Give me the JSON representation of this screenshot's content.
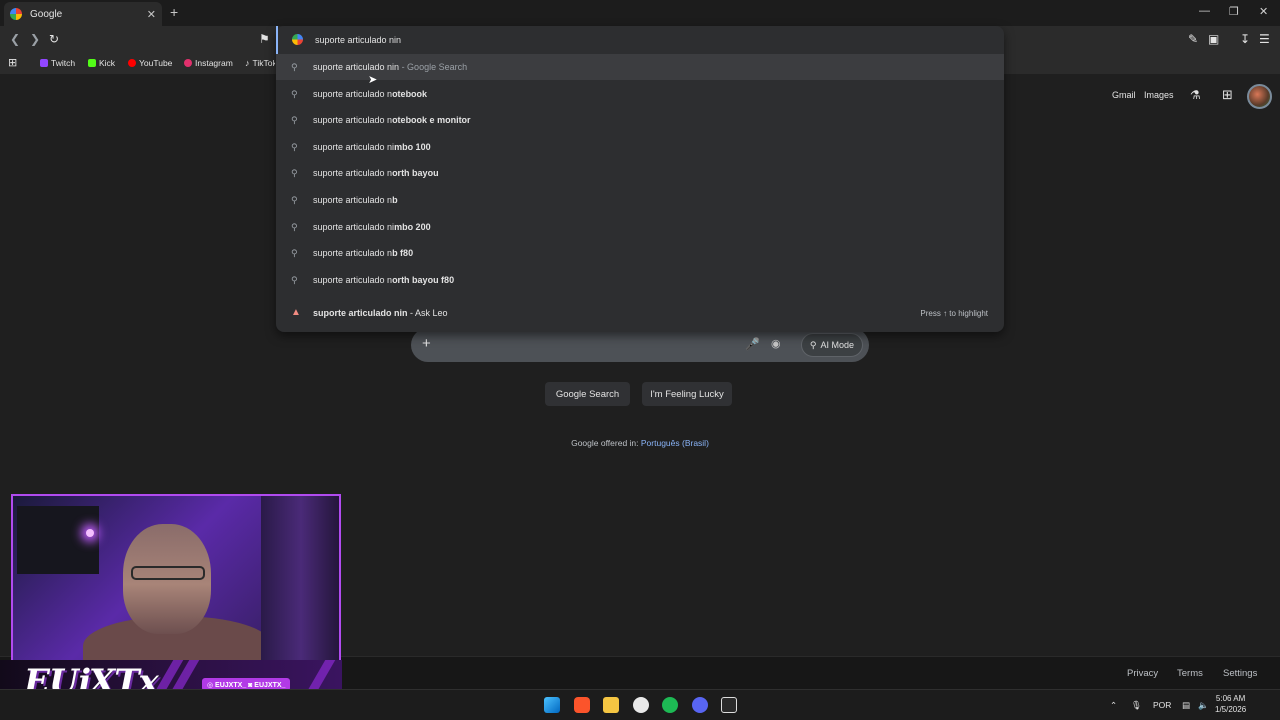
{
  "tab": {
    "title": "Google",
    "close": "✕",
    "new": "+"
  },
  "window": {
    "minimize": "—",
    "restore": "❐",
    "close": "✕"
  },
  "bookmarks": [
    {
      "label": "Twitch",
      "color": "#9146ff"
    },
    {
      "label": "Kick",
      "color": "#53fc18"
    },
    {
      "label": "YouTube",
      "color": "#ff0000"
    },
    {
      "label": "Instagram",
      "color": "#e1306c"
    },
    {
      "label": "TikTok",
      "color": "#ffffff"
    }
  ],
  "omnibox": {
    "value": "suporte articulado nin",
    "suggestions": [
      {
        "prefix": "suporte articulado nin",
        "bold": "",
        "suffix": " - Google Search"
      },
      {
        "prefix": "suporte articulado n",
        "bold": "otebook",
        "suffix": ""
      },
      {
        "prefix": "suporte articulado n",
        "bold": "otebook e monitor",
        "suffix": ""
      },
      {
        "prefix": "suporte articulado ni",
        "bold": "mbo 100",
        "suffix": ""
      },
      {
        "prefix": "suporte articulado n",
        "bold": "orth bayou",
        "suffix": ""
      },
      {
        "prefix": "suporte articulado n",
        "bold": "b",
        "suffix": ""
      },
      {
        "prefix": "suporte articulado ni",
        "bold": "mbo 200",
        "suffix": ""
      },
      {
        "prefix": "suporte articulado n",
        "bold": "b f80",
        "suffix": ""
      },
      {
        "prefix": "suporte articulado n",
        "bold": "orth bayou f80",
        "suffix": ""
      }
    ],
    "ask": {
      "bold": "suporte articulado nin",
      "suffix": " - Ask Leo",
      "hint": "Press ↑ to highlight"
    }
  },
  "header": {
    "gmail": "Gmail",
    "images": "Images"
  },
  "search": {
    "ai_mode": "AI Mode",
    "google_search": "Google Search",
    "lucky": "I'm Feeling Lucky"
  },
  "offered": {
    "text": "Google offered in: ",
    "language": "Português (Brasil)"
  },
  "footer": {
    "privacy": "Privacy",
    "terms": "Terms",
    "settings": "Settings"
  },
  "overlay": {
    "name": "EUjXTx",
    "tags": "◎ EUJXTX_   ◙ EUJXTX_"
  },
  "tray": {
    "lang": "POR",
    "time": "5:06 AM",
    "date": "1/5/2026"
  }
}
